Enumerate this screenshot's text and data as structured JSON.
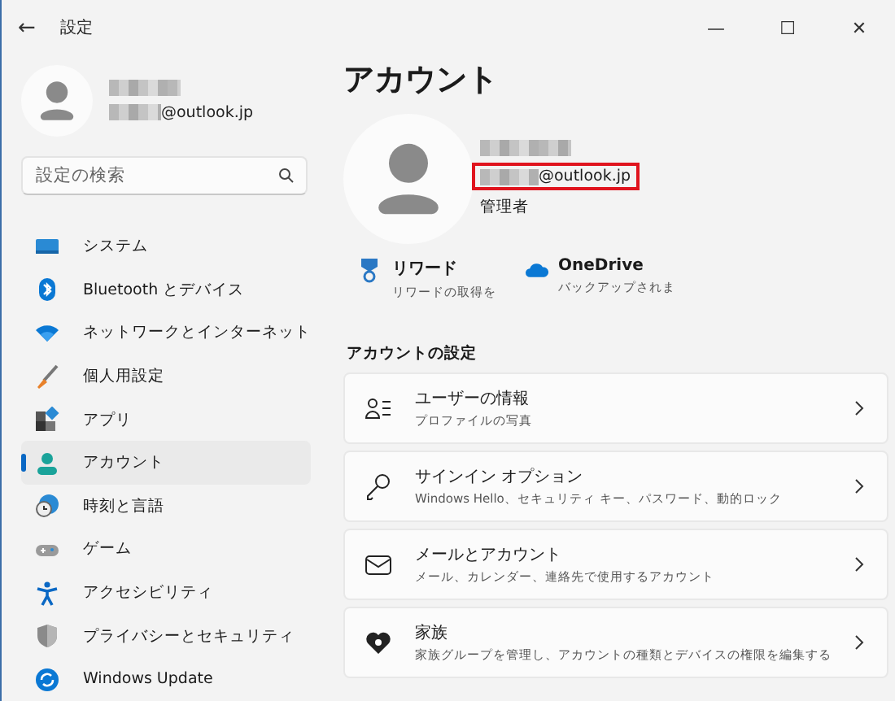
{
  "window": {
    "title": "設定",
    "back": "←",
    "controls": [
      "—",
      "☐",
      "✕"
    ]
  },
  "profile": {
    "email": "@outlook.jp"
  },
  "search": {
    "placeholder": "設定の検索"
  },
  "nav": [
    {
      "label": "システム",
      "selected": false
    },
    {
      "label": "Bluetooth とデバイス",
      "selected": false
    },
    {
      "label": "ネットワークとインターネット",
      "selected": false
    },
    {
      "label": "個人用設定",
      "selected": false
    },
    {
      "label": "アプリ",
      "selected": false
    },
    {
      "label": "アカウント",
      "selected": true
    },
    {
      "label": "時刻と言語",
      "selected": false
    },
    {
      "label": "ゲーム",
      "selected": false
    },
    {
      "label": "アクセシビリティ",
      "selected": false
    },
    {
      "label": "プライバシーとセキュリティ",
      "selected": false
    },
    {
      "label": "Windows Update",
      "selected": false
    }
  ],
  "page": {
    "title": "アカウント",
    "email": "@outlook.jp",
    "email_highlighted": true,
    "role": "管理者",
    "services": [
      {
        "title": "リワード",
        "subtitle": "リワードの取得を"
      },
      {
        "title": "OneDrive",
        "subtitle": "バックアップされま"
      }
    ],
    "section": "アカウントの設定",
    "cards": [
      {
        "title": "ユーザーの情報",
        "subtitle": "プロファイルの写真"
      },
      {
        "title": "サインイン オプション",
        "subtitle": "Windows Hello、セキュリティ キー、パスワード、動的ロック"
      },
      {
        "title": "メールとアカウント",
        "subtitle": "メール、カレンダー、連絡先で使用するアカウント"
      },
      {
        "title": "家族",
        "subtitle": "家族グループを管理し、アカウントの種類とデバイスの権限を編集する"
      }
    ]
  }
}
